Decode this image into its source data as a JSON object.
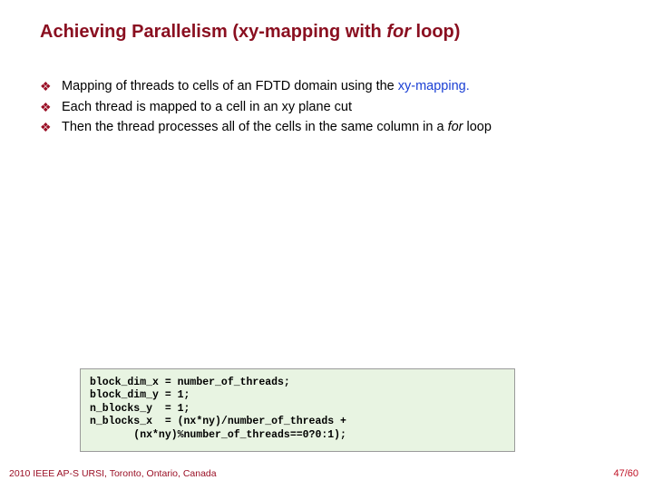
{
  "title": {
    "pre": "Achieving Parallelism (xy-mapping with ",
    "ital": "for",
    "post": " loop)"
  },
  "bullets": [
    {
      "pre": "Mapping of threads to cells of an FDTD domain using the ",
      "link": "xy-mapping",
      "link_dot": ".",
      "post": ""
    },
    {
      "pre": "Each thread is mapped to a cell in an xy plane cut",
      "link": "",
      "link_dot": "",
      "post": ""
    },
    {
      "pre": "Then the thread processes all of the cells in the same column in a ",
      "link": "",
      "link_dot": "",
      "post": "",
      "ital": "for",
      "tail": " loop"
    }
  ],
  "code": {
    "l1": "block_dim_x = number_of_threads;",
    "l2": "block_dim_y = 1;",
    "l3": "n_blocks_y  = 1;",
    "l4": "n_blocks_x  = (nx*ny)/number_of_threads +",
    "l5": "       (nx*ny)%number_of_threads==0?0:1);"
  },
  "footer": {
    "left": "2010 IEEE AP-S URSI, Toronto, Ontario, Canada",
    "right": "47/60"
  },
  "icons": {
    "diamond": "❖"
  }
}
